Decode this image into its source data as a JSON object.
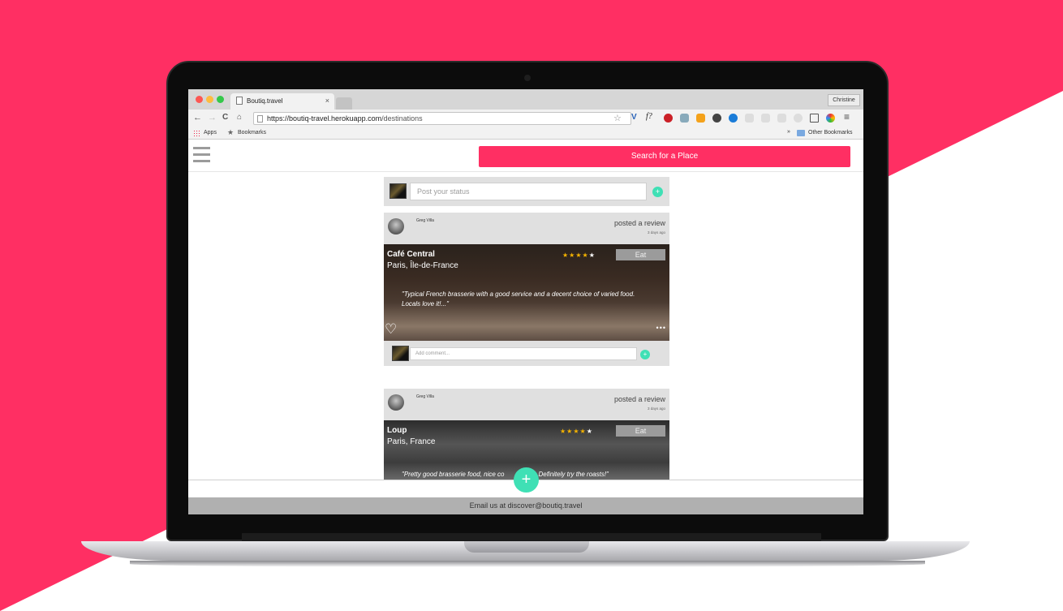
{
  "colors": {
    "brand": "#ff2f63",
    "accent": "#3fe0b5",
    "background_right": "#ffffff"
  },
  "browser": {
    "tab_title": "Boutiq.travel",
    "tab_close": "×",
    "profile": "Christine",
    "url_host": "https://boutiq-travel.herokuapp.com",
    "url_path": "/destinations",
    "bookmarks": {
      "apps": "Apps",
      "bookmarks": "Bookmarks",
      "chevron": "»",
      "other": "Other Bookmarks"
    },
    "extension_labels": {
      "f": "f?",
      "v": "V"
    }
  },
  "header": {
    "search_label": "Search for a Place"
  },
  "status": {
    "placeholder": "Post your status",
    "submit": "+"
  },
  "posts": [
    {
      "author": "Greg Villa",
      "action": "posted a review",
      "time": "3 days ago",
      "place": "Café Central",
      "location": "Paris, Île-de-France",
      "rating": 4,
      "stars_filled": "★★★★",
      "stars_empty": "★",
      "category": "Eat",
      "quote": "\"Typical French brasserie with a good service and a decent choice of varied food. Locals love it!...\"",
      "heart": "♡",
      "more": "•••",
      "comment_placeholder": "Add comment...",
      "comment_submit": "+"
    },
    {
      "author": "Greg Villa",
      "action": "posted a review",
      "time": "3 days ago",
      "place": "Loup",
      "location": "Paris, France",
      "rating": 4,
      "stars_filled": "★★★★",
      "stars_empty": "★",
      "category": "Eat",
      "quote": "\"Pretty good brasserie food, nice co",
      "quote_end": "Definitely try the roasts!\""
    }
  ],
  "fab": "+",
  "footer": "Email us at discover@boutiq.travel"
}
